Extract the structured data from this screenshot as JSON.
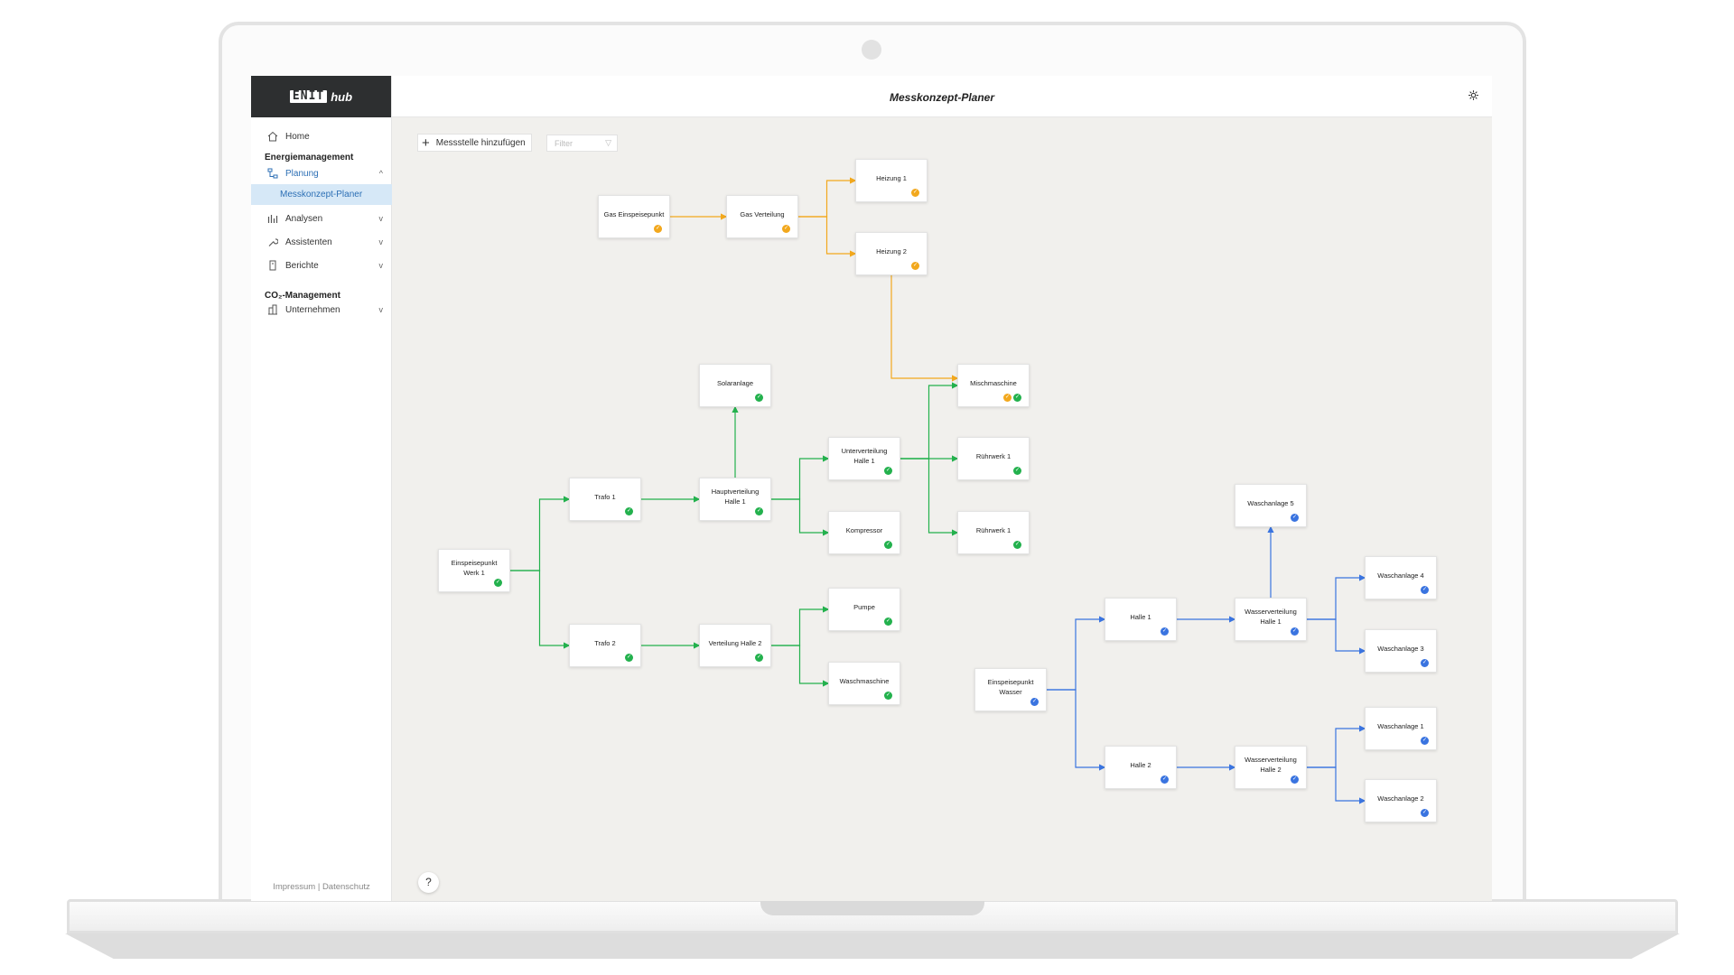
{
  "app": {
    "logo_mark": "ENIT",
    "logo_text": "hub"
  },
  "sidebar": {
    "home": "Home",
    "section_energy": "Energiemanagement",
    "planung": "Planung",
    "messkonzept": "Messkonzept-Planer",
    "analysen": "Analysen",
    "assistenten": "Assistenten",
    "berichte": "Berichte",
    "section_co2": "CO₂-Management",
    "unternehmen": "Unternehmen",
    "footer": "Impressum | Datenschutz"
  },
  "header": {
    "title": "Messkonzept-Planer"
  },
  "toolbar": {
    "add_label": "Messstelle hinzufügen",
    "filter_placeholder": "Filter"
  },
  "help": "?",
  "colors": {
    "gas": "#f2a81d",
    "power": "#23b14d",
    "water": "#3a74e0"
  },
  "nodes": [
    {
      "id": "gas_ein",
      "label": "Gas Einspeisepunkt",
      "badges": [
        "gas"
      ]
    },
    {
      "id": "gas_vert",
      "label": "Gas Verteilung",
      "badges": [
        "gas"
      ]
    },
    {
      "id": "heiz1",
      "label": "Heizung 1",
      "badges": [
        "gas"
      ]
    },
    {
      "id": "heiz2",
      "label": "Heizung 2",
      "badges": [
        "gas"
      ]
    },
    {
      "id": "solar",
      "label": "Solaranlage",
      "badges": [
        "power"
      ]
    },
    {
      "id": "misch",
      "label": "Mischmaschine",
      "badges": [
        "gas",
        "power"
      ]
    },
    {
      "id": "unter",
      "label": "Unterverteilung Halle 1",
      "badges": [
        "power"
      ]
    },
    {
      "id": "ruehr1",
      "label": "Rührwerk 1",
      "badges": [
        "power"
      ]
    },
    {
      "id": "trafo1",
      "label": "Trafo 1",
      "badges": [
        "power"
      ]
    },
    {
      "id": "hauptv",
      "label": "Hauptverteilung Halle 1",
      "badges": [
        "power"
      ]
    },
    {
      "id": "kompr",
      "label": "Kompressor",
      "badges": [
        "power"
      ]
    },
    {
      "id": "ruehr1b",
      "label": "Rührwerk 1",
      "badges": [
        "power"
      ]
    },
    {
      "id": "einspw",
      "label": "Einspeisepunkt Werk 1",
      "badges": [
        "power"
      ]
    },
    {
      "id": "pumpe",
      "label": "Pumpe",
      "badges": [
        "power"
      ]
    },
    {
      "id": "trafo2",
      "label": "Trafo 2",
      "badges": [
        "power"
      ]
    },
    {
      "id": "verth2",
      "label": "Verteilung Halle 2",
      "badges": [
        "power"
      ]
    },
    {
      "id": "waschm",
      "label": "Waschmaschine",
      "badges": [
        "power"
      ]
    },
    {
      "id": "wa5",
      "label": "Waschanlage 5",
      "badges": [
        "water"
      ]
    },
    {
      "id": "wa4",
      "label": "Waschanlage 4",
      "badges": [
        "water"
      ]
    },
    {
      "id": "halle1",
      "label": "Halle 1",
      "badges": [
        "water"
      ]
    },
    {
      "id": "wv1",
      "label": "Wasserverteilung Halle 1",
      "badges": [
        "water"
      ]
    },
    {
      "id": "wa3",
      "label": "Waschanlage 3",
      "badges": [
        "water"
      ]
    },
    {
      "id": "einwas",
      "label": "Einspeisepunkt Wasser",
      "badges": [
        "water"
      ]
    },
    {
      "id": "wa1",
      "label": "Waschanlage 1",
      "badges": [
        "water"
      ]
    },
    {
      "id": "halle2",
      "label": "Halle 2",
      "badges": [
        "water"
      ]
    },
    {
      "id": "wv2",
      "label": "Wasserverteilung Halle 2",
      "badges": [
        "water"
      ]
    },
    {
      "id": "wa2",
      "label": "Waschanlage 2",
      "badges": [
        "water"
      ]
    }
  ],
  "edges": [
    {
      "from": "gas_ein",
      "to": "gas_vert",
      "type": "gas"
    },
    {
      "from": "gas_vert",
      "to": "heiz1",
      "type": "gas"
    },
    {
      "from": "gas_vert",
      "to": "heiz2",
      "type": "gas"
    },
    {
      "from": "heiz2",
      "to": "misch",
      "type": "gas"
    },
    {
      "from": "einspw",
      "to": "trafo1",
      "type": "power"
    },
    {
      "from": "einspw",
      "to": "trafo2",
      "type": "power"
    },
    {
      "from": "trafo1",
      "to": "hauptv",
      "type": "power"
    },
    {
      "from": "hauptv",
      "to": "solar",
      "type": "power"
    },
    {
      "from": "hauptv",
      "to": "unter",
      "type": "power"
    },
    {
      "from": "hauptv",
      "to": "kompr",
      "type": "power"
    },
    {
      "from": "unter",
      "to": "misch",
      "type": "power"
    },
    {
      "from": "unter",
      "to": "ruehr1",
      "type": "power"
    },
    {
      "from": "unter",
      "to": "ruehr1b",
      "type": "power"
    },
    {
      "from": "trafo2",
      "to": "verth2",
      "type": "power"
    },
    {
      "from": "verth2",
      "to": "pumpe",
      "type": "power"
    },
    {
      "from": "verth2",
      "to": "waschm",
      "type": "power"
    },
    {
      "from": "einwas",
      "to": "halle1",
      "type": "water"
    },
    {
      "from": "einwas",
      "to": "halle2",
      "type": "water"
    },
    {
      "from": "halle1",
      "to": "wv1",
      "type": "water"
    },
    {
      "from": "wv1",
      "to": "wa5",
      "type": "water"
    },
    {
      "from": "wv1",
      "to": "wa4",
      "type": "water"
    },
    {
      "from": "wv1",
      "to": "wa3",
      "type": "water"
    },
    {
      "from": "halle2",
      "to": "wv2",
      "type": "water"
    },
    {
      "from": "wv2",
      "to": "wa1",
      "type": "water"
    },
    {
      "from": "wv2",
      "to": "wa2",
      "type": "water"
    }
  ]
}
